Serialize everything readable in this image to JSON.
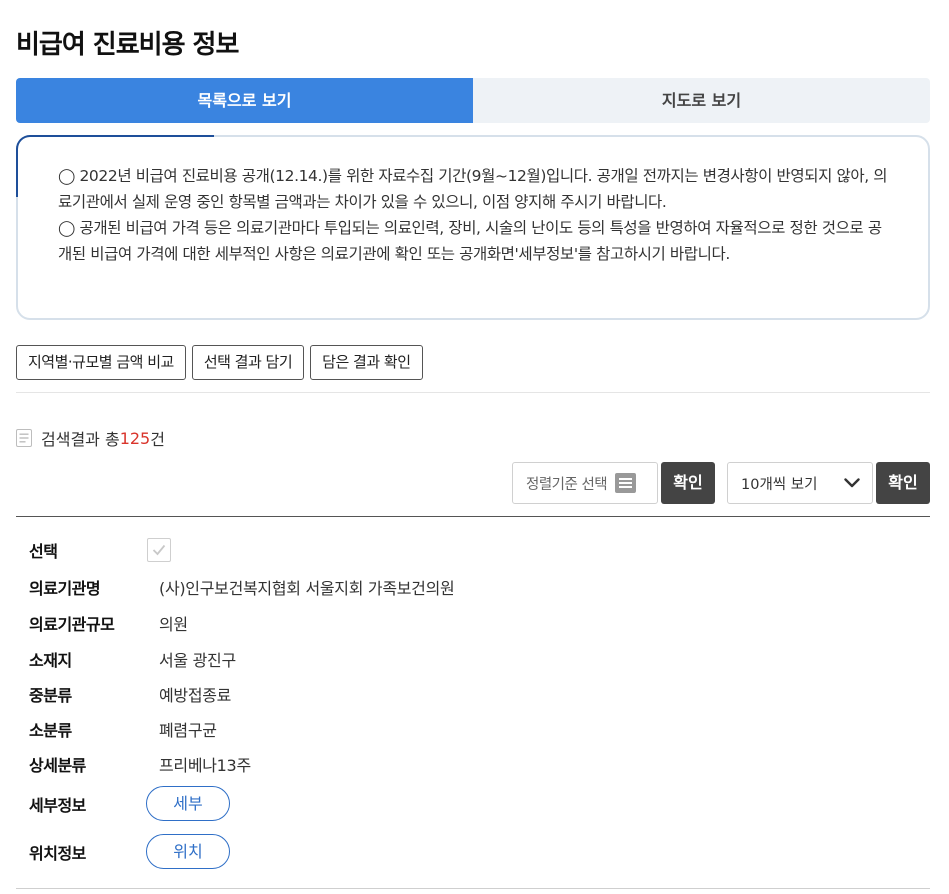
{
  "page": {
    "title": "비급여 진료비용 정보"
  },
  "tabs": [
    {
      "label": "목록으로 보기",
      "active": true
    },
    {
      "label": "지도로 보기",
      "active": false
    }
  ],
  "notice": {
    "line1": "◯ 2022년 비급여 진료비용 공개(12.14.)를 위한 자료수집 기간(9월~12월)입니다. 공개일 전까지는 변경사항이 반영되지 않아, 의료기관에서 실제 운영 중인 항목별 금액과는 차이가 있을 수 있으니, 이점 양지해 주시기 바랍니다.",
    "line2": "◯ 공개된 비급여 가격 등은 의료기관마다 투입되는 의료인력, 장비, 시술의 난이도 등의 특성을 반영하여 자율적으로 정한 것으로 공개된 비급여 가격에 대한 세부적인 사항은 의료기관에 확인 또는 공개화면'세부정보'를 참고하시기 바랍니다."
  },
  "actions": {
    "compare": "지역별·규모별 금액 비교",
    "save_selection": "선택 결과 담기",
    "view_saved": "담은 결과 확인"
  },
  "result": {
    "prefix": "검색결과 총",
    "count": "125",
    "suffix": "건"
  },
  "controls": {
    "sort_placeholder": "정렬기준 선택",
    "confirm_label": "확인",
    "page_size": "10개씩 보기"
  },
  "record": {
    "select_label": "선택",
    "checked": false,
    "fields": [
      {
        "label": "의료기관명",
        "value": "(사)인구보건복지협회 서울지회 가족보건의원"
      },
      {
        "label": "의료기관규모",
        "value": "의원"
      },
      {
        "label": "소재지",
        "value": "서울 광진구"
      },
      {
        "label": "중분류",
        "value": "예방접종료"
      },
      {
        "label": "소분류",
        "value": "폐렴구균"
      },
      {
        "label": "상세분류",
        "value": "프리베나13주"
      }
    ],
    "detail_label": "세부정보",
    "detail_button": "세부",
    "location_label": "위치정보",
    "location_button": "위치"
  },
  "colors": {
    "accent": "#3a84e0",
    "count": "#d9342b",
    "pill": "#2f6fc7",
    "dark_button": "#444444"
  }
}
